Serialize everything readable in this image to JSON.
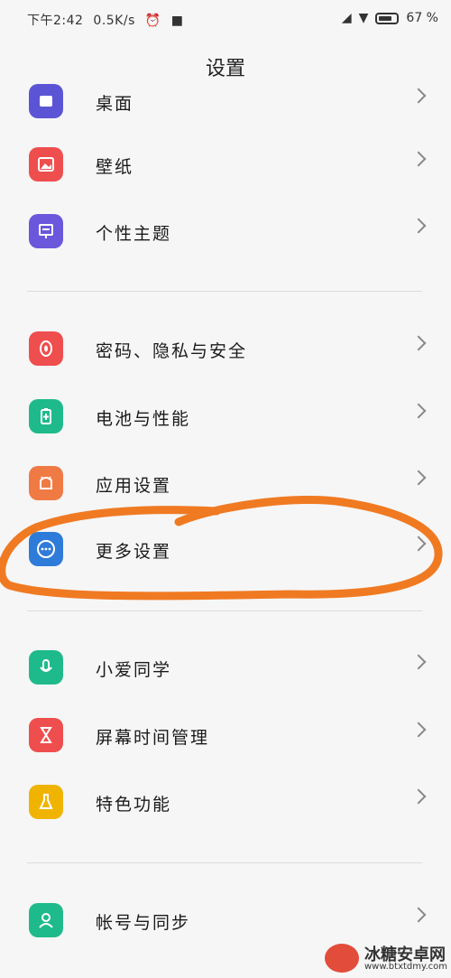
{
  "status_bar": {
    "time": "下午2:42",
    "speed": "0.5K/s",
    "battery_pct": "67 %"
  },
  "header": {
    "title": "设置"
  },
  "items": [
    {
      "label": "桌面",
      "icon": "desktop-icon",
      "color": "#5b55d6"
    },
    {
      "label": "壁纸",
      "icon": "wallpaper-icon",
      "color": "#ef4e4e"
    },
    {
      "label": "个性主题",
      "icon": "theme-icon",
      "color": "#6a57db"
    },
    {
      "label": "密码、隐私与安全",
      "icon": "privacy-icon",
      "color": "#ef4e4e"
    },
    {
      "label": "电池与性能",
      "icon": "battery-icon",
      "color": "#1fba8b"
    },
    {
      "label": "应用设置",
      "icon": "app-settings-icon",
      "color": "#f07a44"
    },
    {
      "label": "更多设置",
      "icon": "more-settings-icon",
      "color": "#2f7bd9"
    },
    {
      "label": "小爱同学",
      "icon": "mic-icon",
      "color": "#1fba8b"
    },
    {
      "label": "屏幕时间管理",
      "icon": "hourglass-icon",
      "color": "#ef4e4e"
    },
    {
      "label": "特色功能",
      "icon": "flask-icon",
      "color": "#f0b400"
    },
    {
      "label": "帐号与同步",
      "icon": "account-icon",
      "color": "#1fba8b"
    }
  ],
  "annotation": {
    "color": "#f07a22",
    "target": "更多设置"
  },
  "watermark": {
    "name": "冰糖安卓网",
    "url": "www.btxtdmy.com"
  }
}
